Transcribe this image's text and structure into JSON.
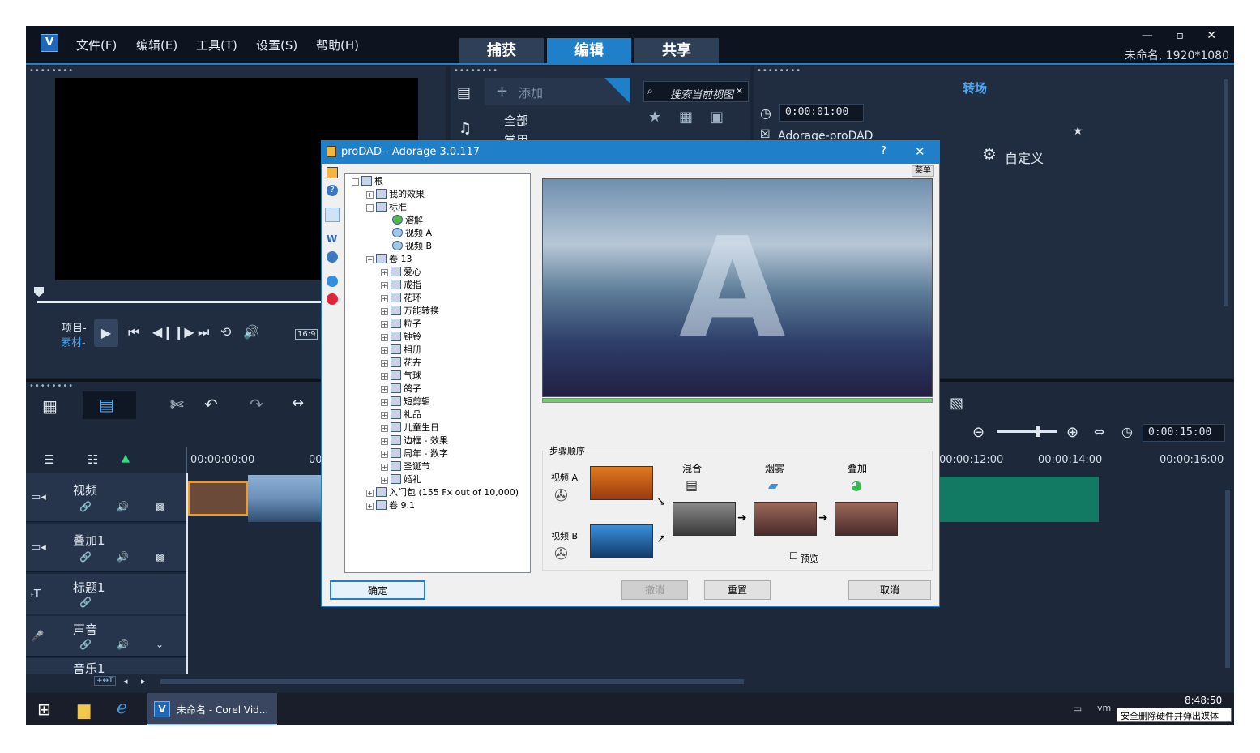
{
  "menubar": {
    "items": [
      "文件(F)",
      "编辑(E)",
      "工具(T)",
      "设置(S)",
      "帮助(H)"
    ],
    "tabs": [
      "捕获",
      "编辑",
      "共享"
    ],
    "active_tab": "编辑",
    "window_controls": "— ▫ ✕",
    "project_info": "未命名, 1920*1080"
  },
  "preview": {
    "project_label": "项目-",
    "clip_label": "素材-",
    "aspect": "16:9"
  },
  "library": {
    "add_label": "添加",
    "categories": [
      "全部",
      "常用"
    ],
    "search_placeholder": "搜索当前视图"
  },
  "options": {
    "title": "转场",
    "duration": "0:00:01:00",
    "effect_name": "Adorage-proDAD",
    "customize_label": "自定义"
  },
  "timeline": {
    "zoom_time": "0:00:15:00",
    "ruler": [
      "00:00:00:00",
      "00",
      "00:00:12:00",
      "00:00:14:00",
      "00:00:16:00"
    ],
    "tracks": [
      {
        "name": "视频",
        "icon": "video-track-icon"
      },
      {
        "name": "叠加1",
        "icon": "overlay-track-icon"
      },
      {
        "name": "标题1",
        "icon": "title-track-icon"
      },
      {
        "name": "声音",
        "icon": "voice-track-icon"
      },
      {
        "name": "音乐1",
        "icon": "music-track-icon"
      }
    ]
  },
  "dialog": {
    "title": "proDAD - Adorage 3.0.117",
    "help": "?",
    "close": "✕",
    "menu_button": "菜单",
    "tree": {
      "root": "根",
      "my_effects": "我的效果",
      "standard": "标准",
      "standard_children": [
        "溶解",
        "视频 A",
        "视频 B"
      ],
      "volume13": "卷 13",
      "volume13_children": [
        "爱心",
        "戒指",
        "花环",
        "万能转换",
        "粒子",
        "钟铃",
        "相册",
        "花卉",
        "气球",
        "鸽子",
        "短剪辑",
        "礼品",
        "儿童生日",
        "边框 - 效果",
        "周年 - 数字",
        "圣诞节",
        "婚礼"
      ],
      "starter_pack": "入门包 (155 Fx out of 10,000)",
      "volume91": "卷 9.1"
    },
    "steps_title": "步骤顺序",
    "video_a": "视频 A",
    "video_b": "视频 B",
    "stages": [
      "混合",
      "烟雾",
      "叠加"
    ],
    "preview_checkbox": "预览",
    "buttons": {
      "ok": "确定",
      "undo": "撤消",
      "reset": "重置",
      "cancel": "取消"
    }
  },
  "taskbar": {
    "app_label": "未命名 - Corel Vid...",
    "time": "8:48:50",
    "tooltip": "安全删除硬件并弹出媒体"
  }
}
